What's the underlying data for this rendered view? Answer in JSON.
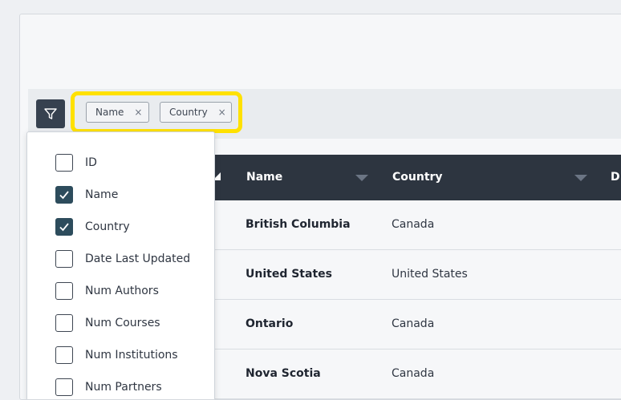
{
  "toolbar": {
    "filter_chips": [
      {
        "label": "Name",
        "remove": "×"
      },
      {
        "label": "Country",
        "remove": "×"
      }
    ]
  },
  "table": {
    "columns": [
      "Name",
      "Country",
      "D"
    ],
    "rows": [
      {
        "name": "British Columbia",
        "country": "Canada"
      },
      {
        "name": "United States",
        "country": "United States"
      },
      {
        "name": "Ontario",
        "country": "Canada"
      },
      {
        "name": "Nova Scotia",
        "country": "Canada"
      }
    ]
  },
  "column_menu": {
    "options": [
      {
        "label": "ID",
        "checked": false
      },
      {
        "label": "Name",
        "checked": true
      },
      {
        "label": "Country",
        "checked": true
      },
      {
        "label": "Date Last Updated",
        "checked": false
      },
      {
        "label": "Num Authors",
        "checked": false
      },
      {
        "label": "Num Courses",
        "checked": false
      },
      {
        "label": "Num Institutions",
        "checked": false
      },
      {
        "label": "Num Partners",
        "checked": false
      }
    ]
  },
  "colors": {
    "header_bg": "#2d3540",
    "highlight": "#ffe100",
    "checkbox_checked": "#2d4c5c"
  }
}
